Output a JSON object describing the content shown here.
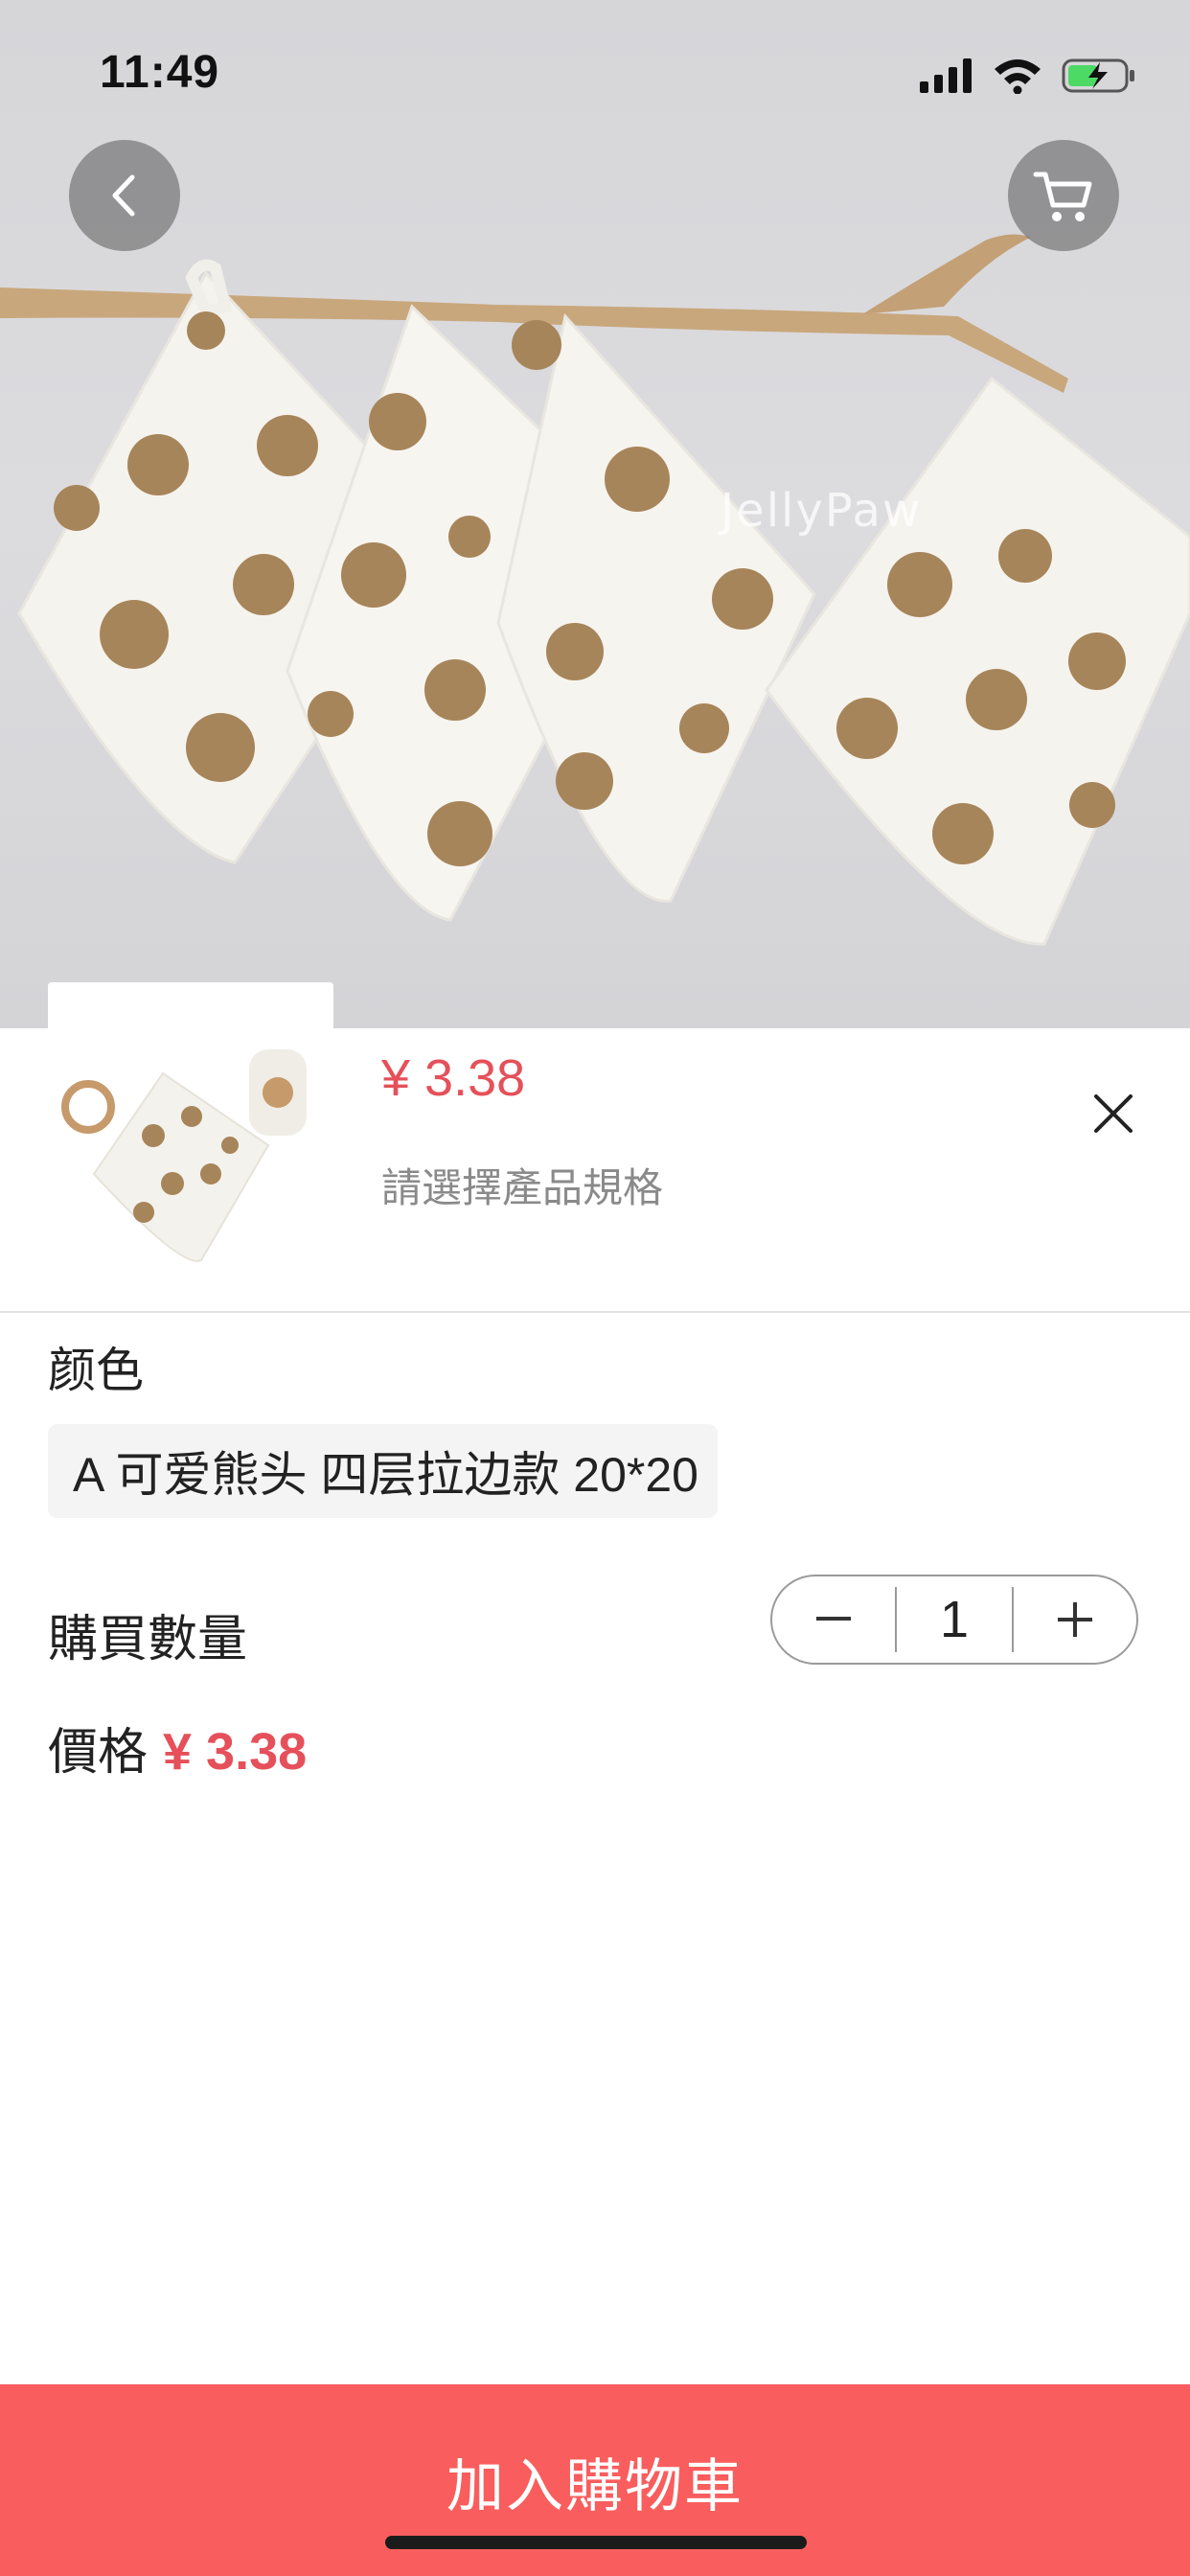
{
  "status_bar": {
    "time": "11:49",
    "icons": [
      "signal-icon",
      "wifi-icon",
      "battery-charging-icon"
    ]
  },
  "hero": {
    "watermark": "JellyPaw",
    "back_icon": "chevron-left-icon",
    "cart_icon": "shopping-cart-icon"
  },
  "sheet": {
    "price": "¥ 3.38",
    "spec_hint": "請選擇產品規格",
    "close_icon": "close-icon",
    "color_label": "颜色",
    "options": [
      "A 可爱熊头 四层拉边款 20*20"
    ],
    "quantity_label": "購買數量",
    "quantity_value": "1",
    "minus_icon": "minus-icon",
    "plus_icon": "plus-icon",
    "total_label": "價格",
    "total_price": "¥ 3.38"
  },
  "footer": {
    "add_to_cart_label": "加入購物車"
  },
  "colors": {
    "accent_red": "#f95d5d",
    "price_red": "#e5505a"
  }
}
